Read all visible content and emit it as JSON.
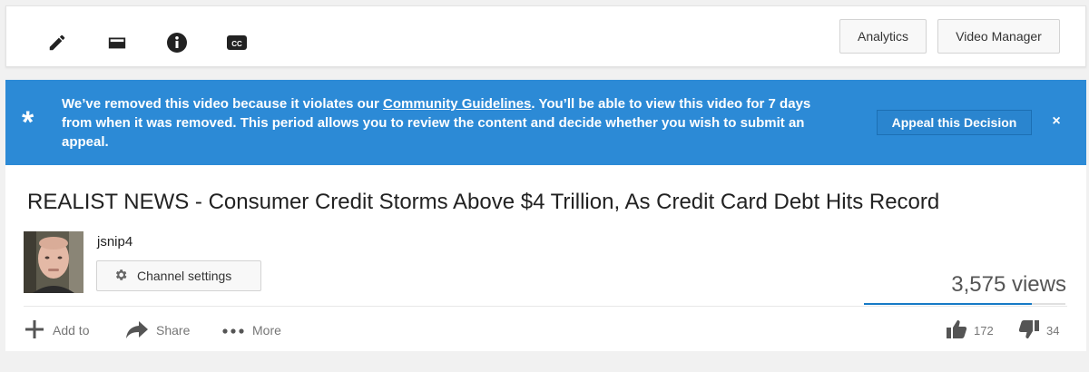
{
  "toolbar": {
    "icons": [
      "pencil-icon",
      "card-icon",
      "info-icon",
      "cc-icon"
    ],
    "analytics_label": "Analytics",
    "video_manager_label": "Video Manager"
  },
  "banner": {
    "text_before_link": "We’ve removed this video because it violates our ",
    "link_text": "Community Guidelines",
    "text_after_link": ". You’ll be able to view this video for 7 days from when it was removed. This period allows you to review the content and decide whether you wish to submit an appeal.",
    "appeal_label": "Appeal this Decision",
    "close_symbol": "×",
    "star_symbol": "*",
    "color": "#2c8ad6"
  },
  "video": {
    "title": "REALIST NEWS - Consumer Credit Storms Above $4 Trillion, As Credit Card Debt Hits Record",
    "channel_name": "jsnip4",
    "channel_settings_label": "Channel settings",
    "views": "3,575 views",
    "like_ratio": 0.835,
    "likes": "172",
    "dislikes": "34"
  },
  "actions": {
    "add_to_label": "Add to",
    "share_label": "Share",
    "more_label": "More"
  },
  "colors": {
    "accent": "#167ac6",
    "background": "#f1f1f1"
  }
}
